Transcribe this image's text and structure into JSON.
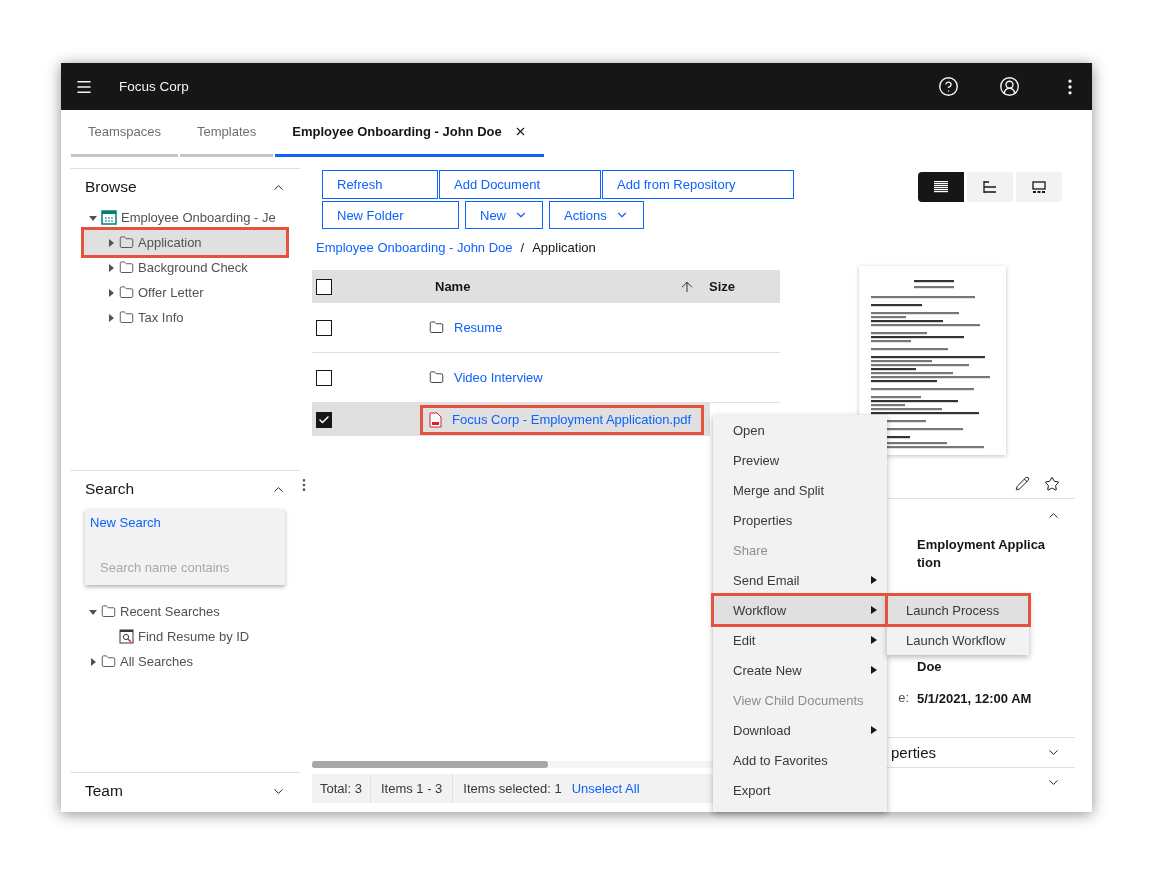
{
  "header": {
    "title": "Focus Corp"
  },
  "tabs": [
    {
      "label": "Teamspaces",
      "selected": false,
      "closable": false
    },
    {
      "label": "Templates",
      "selected": false,
      "closable": false
    },
    {
      "label": "Employee Onboarding - John Doe",
      "selected": true,
      "closable": true
    }
  ],
  "browse": {
    "title": "Browse",
    "expanded": true,
    "tree": [
      {
        "label": "Employee Onboarding - Je",
        "kind": "teamspace",
        "expanded": true,
        "selected": false,
        "highlighted": false,
        "children": [
          {
            "label": "Application",
            "kind": "folder",
            "expanded": false,
            "selected": true,
            "highlighted": true
          },
          {
            "label": "Background Check",
            "kind": "folder",
            "expanded": false,
            "selected": false,
            "highlighted": false
          },
          {
            "label": "Offer Letter",
            "kind": "folder",
            "expanded": false,
            "selected": false,
            "highlighted": false
          },
          {
            "label": "Tax Info",
            "kind": "folder",
            "expanded": false,
            "selected": false,
            "highlighted": false
          }
        ]
      }
    ]
  },
  "search": {
    "title": "Search",
    "expanded": true,
    "new_search": "New Search",
    "placeholder": "Search name contains",
    "tree": [
      {
        "label": "Recent Searches",
        "kind": "folder",
        "expanded": true,
        "selected": false,
        "highlighted": false,
        "children": [
          {
            "label": "Find Resume by ID",
            "kind": "search",
            "selected": false,
            "highlighted": false
          }
        ]
      },
      {
        "label": "All Searches",
        "kind": "folder",
        "expanded": false,
        "selected": false,
        "highlighted": false
      }
    ]
  },
  "team": {
    "title": "Team",
    "expanded": false
  },
  "toolbar": {
    "rows": [
      [
        {
          "label": "Refresh",
          "kind": "button"
        },
        {
          "label": "Add Document",
          "kind": "button"
        },
        {
          "label": "Add from Repository",
          "kind": "button"
        }
      ],
      [
        {
          "label": "New Folder",
          "kind": "button"
        },
        {
          "label": "New",
          "kind": "dropdown"
        },
        {
          "label": "Actions",
          "kind": "dropdown"
        }
      ]
    ]
  },
  "breadcrumb": {
    "separator": "/",
    "items": [
      {
        "label": "Employee Onboarding - John Doe",
        "kind": "link"
      },
      {
        "label": "Application",
        "kind": "current"
      }
    ]
  },
  "table": {
    "all_checked": false,
    "columns": [
      {
        "label": "Name",
        "sorted": true
      },
      {
        "label": "Size",
        "sorted": false
      }
    ],
    "rows": [
      {
        "name": "Resume",
        "kind": "folder",
        "checked": false,
        "highlighted": false
      },
      {
        "name": "Video Interview",
        "kind": "folder",
        "checked": false,
        "highlighted": false
      },
      {
        "name": "Focus Corp - Employment Application.pdf",
        "kind": "pdf",
        "checked": true,
        "highlighted": true
      }
    ]
  },
  "status_bar": {
    "total": "Total: 3",
    "range": "Items 1 - 3",
    "selected": "Items selected: 1",
    "unselect": "Unselect All"
  },
  "view_switcher": [
    {
      "kind": "details",
      "selected": true
    },
    {
      "kind": "tree",
      "selected": false
    },
    {
      "kind": "filmstrip",
      "selected": false
    }
  ],
  "details": {
    "fields": [
      {
        "value": "Employment Application"
      },
      {
        "value": "Doe"
      },
      {
        "label": "e:",
        "value": "5/1/2021, 12:00 AM"
      }
    ],
    "sections": [
      {
        "title": "perties",
        "expanded": false
      },
      {
        "expanded": false
      }
    ]
  },
  "context_menu": {
    "items": [
      {
        "label": "Open",
        "disabled": false,
        "submenu": false,
        "selected": false
      },
      {
        "label": "Preview",
        "disabled": false,
        "submenu": false,
        "selected": false
      },
      {
        "label": "Merge and Split",
        "disabled": false,
        "submenu": false,
        "selected": false
      },
      {
        "label": "Properties",
        "disabled": false,
        "submenu": false,
        "selected": false
      },
      {
        "label": "Share",
        "disabled": true,
        "submenu": false,
        "selected": false
      },
      {
        "label": "Send Email",
        "disabled": false,
        "submenu": true,
        "selected": false
      },
      {
        "label": "Workflow",
        "disabled": false,
        "submenu": true,
        "selected": true
      },
      {
        "label": "Edit",
        "disabled": false,
        "submenu": true,
        "selected": false
      },
      {
        "label": "Create New",
        "disabled": false,
        "submenu": true,
        "selected": false
      },
      {
        "label": "View Child Documents",
        "disabled": true,
        "submenu": false,
        "selected": false
      },
      {
        "label": "Download",
        "disabled": false,
        "submenu": true,
        "selected": false
      },
      {
        "label": "Add to Favorites",
        "disabled": false,
        "submenu": false,
        "selected": false
      },
      {
        "label": "Export",
        "disabled": false,
        "submenu": false,
        "selected": false
      }
    ],
    "submenu": [
      {
        "label": "Launch Process",
        "selected": true
      },
      {
        "label": "Launch Workflow",
        "selected": false
      }
    ]
  }
}
